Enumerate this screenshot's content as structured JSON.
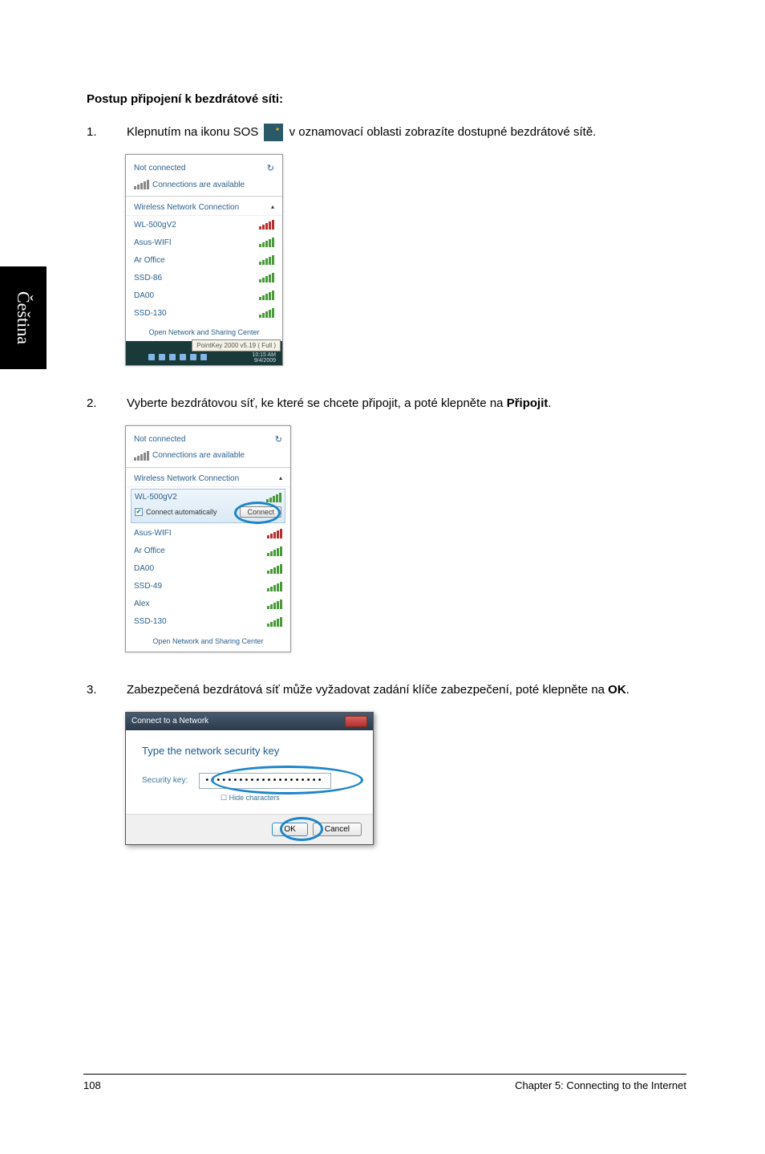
{
  "side_tab": "Čeština",
  "heading": "Postup připojení k bezdrátové síti:",
  "step1": {
    "num": "1.",
    "text_a": "Klepnutím na ikonu SOS ",
    "text_b": " v oznamovací oblasti zobrazíte dostupné bezdrátové sítě."
  },
  "step2": {
    "num": "2.",
    "text": "Vyberte bezdrátovou síť, ke které se chcete připojit, a poté klepněte na ",
    "bold": "Připojit",
    "tail": "."
  },
  "step3": {
    "num": "3.",
    "text": "Zabezpečená bezdrátová síť může vyžadovat zadání klíče zabezpečení, poté klepněte na ",
    "bold": "OK",
    "tail": "."
  },
  "popup1": {
    "not_connected": "Not connected",
    "available": "Connections are available",
    "wnc": "Wireless Network Connection",
    "items": [
      "WL-500gV2",
      "Asus-WIFI",
      "Ar Office",
      "SSD-86",
      "DA00",
      "SSD-130"
    ],
    "foot": "Open Network and Sharing Center",
    "tip": "PointKey 2000 v5.19 ( Full )",
    "time_a": "10:15 AM",
    "time_b": "9/4/2009"
  },
  "popup2": {
    "not_connected": "Not connected",
    "available": "Connections are available",
    "wnc": "Wireless Network Connection",
    "selected": "WL-500gV2",
    "connect_auto": "Connect automatically",
    "connect": "Connect",
    "items": [
      "Asus-WIFI",
      "Ar Office",
      "DA00",
      "SSD-49",
      "Alex",
      "SSD-130"
    ],
    "foot": "Open Network and Sharing Center"
  },
  "dialog3": {
    "title": "Connect to a Network",
    "heading": "Type the network security key",
    "label": "Security key:",
    "value": "•••••••••••••••••••••",
    "hide": "Hide characters",
    "ok": "OK",
    "cancel": "Cancel"
  },
  "footer": {
    "page": "108",
    "chapter": "Chapter 5: Connecting to the Internet"
  }
}
